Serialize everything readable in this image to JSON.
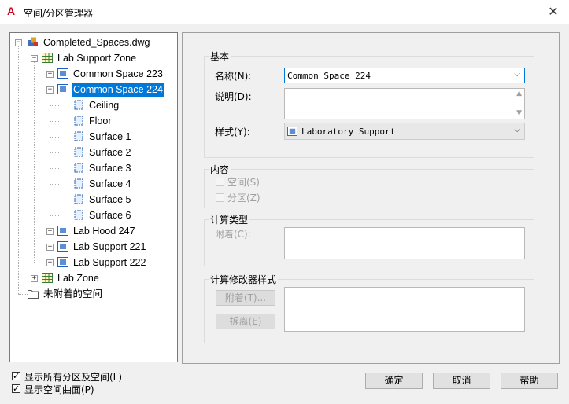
{
  "window": {
    "title": "空间/分区管理器",
    "close_glyph": "✕",
    "app_glyph": "A"
  },
  "tree": {
    "root": "Completed_Spaces.dwg",
    "zone_lab_support": "Lab Support Zone",
    "space_223": "Common Space 223",
    "space_224": "Common Space 224",
    "surfaces": [
      "Ceiling",
      "Floor",
      "Surface 1",
      "Surface 2",
      "Surface 3",
      "Surface 4",
      "Surface 5",
      "Surface 6"
    ],
    "lab_hood": "Lab Hood 247",
    "lab_support_221": "Lab Support 221",
    "lab_support_222": "Lab Support 222",
    "lab_zone": "Lab Zone",
    "unattached": "未附着的空间"
  },
  "basic": {
    "group_title": "基本",
    "name_label": "名称(N):",
    "name_value": "Common Space 224",
    "desc_label": "说明(D):",
    "desc_value": "",
    "style_label": "样式(Y):",
    "style_value": "Laboratory Support"
  },
  "content": {
    "group_title": "内容",
    "space": "空间(S)",
    "zone": "分区(Z)"
  },
  "calc_type": {
    "group_title": "计算类型",
    "attach_label": "附着(C):"
  },
  "calc_mod": {
    "group_title": "计算修改器样式",
    "attach_btn": "附着(T)...",
    "detach_btn": "拆离(E)"
  },
  "options": {
    "show_all": "显示所有分区及空间(L)",
    "show_surfaces": "显示空间曲面(P)"
  },
  "buttons": {
    "ok": "确定",
    "cancel": "取消",
    "help": "帮助"
  }
}
